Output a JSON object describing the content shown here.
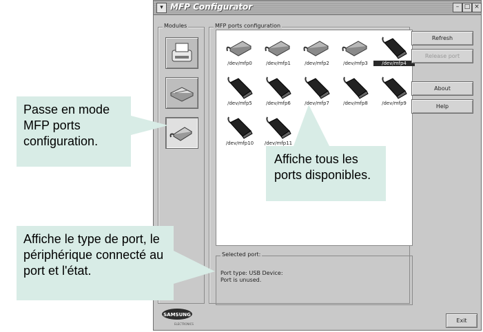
{
  "window": {
    "title": "MFP Configurator",
    "menu_glyph": "▾",
    "min_glyph": "–",
    "max_glyph": "□",
    "close_glyph": "×"
  },
  "modules": {
    "label": "Modules"
  },
  "ports_config": {
    "label": "MFP ports configuration",
    "ports": [
      {
        "label": "/dev/mfp0",
        "kind": "parallel"
      },
      {
        "label": "/dev/mfp1",
        "kind": "parallel"
      },
      {
        "label": "/dev/mfp2",
        "kind": "parallel"
      },
      {
        "label": "/dev/mfp3",
        "kind": "parallel"
      },
      {
        "label": "/dev/mfp4",
        "kind": "usb",
        "selected": true
      },
      {
        "label": "/dev/mfp5",
        "kind": "usb"
      },
      {
        "label": "/dev/mfp6",
        "kind": "usb"
      },
      {
        "label": "/dev/mfp7",
        "kind": "usb"
      },
      {
        "label": "/dev/mfp8",
        "kind": "usb"
      },
      {
        "label": "/dev/mfp9",
        "kind": "usb"
      },
      {
        "label": "/dev/mfp10",
        "kind": "usb"
      },
      {
        "label": "/dev/mfp11",
        "kind": "usb"
      }
    ]
  },
  "buttons": {
    "refresh": "Refresh",
    "release_port": "Release port",
    "about": "About",
    "help": "Help",
    "exit": "Exit"
  },
  "selected_port": {
    "label": "Selected port:",
    "line1": "Port type: USB   Device:",
    "line2": "Port is unused."
  },
  "logo": {
    "brand": "SAMSUNG",
    "sub": "ELECTRONICS"
  },
  "callouts": {
    "mode": "Passe en mode MFP ports configuration.",
    "ports": "Affiche tous les ports disponibles.",
    "type": "Affiche le type de port, le périphérique connecté au port et l'état."
  },
  "colors": {
    "callout_bg": "#d8ece6",
    "window_bg": "#c9c9c9",
    "port_usb": "#222222",
    "port_parallel": "#b8b8b8"
  }
}
